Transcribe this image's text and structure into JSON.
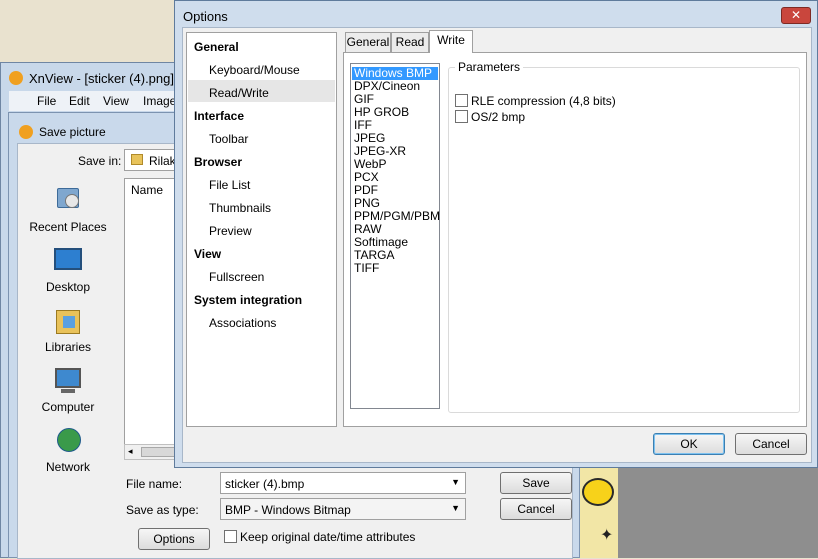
{
  "xnview": {
    "title": "XnView - [sticker (4).png]",
    "menu": [
      "File",
      "Edit",
      "View",
      "Image"
    ]
  },
  "save_dialog": {
    "title": "Save picture",
    "save_in_label": "Save in:",
    "save_in_value": "Rilakku",
    "column_name": "Name",
    "places": [
      "Recent Places",
      "Desktop",
      "Libraries",
      "Computer",
      "Network"
    ],
    "file_name_label": "File name:",
    "file_name_value": "sticker (4).bmp",
    "save_type_label": "Save as type:",
    "save_type_value": "BMP - Windows Bitmap",
    "save_button": "Save",
    "cancel_button": "Cancel",
    "options_button": "Options",
    "keep_date_label": "Keep original date/time attributes"
  },
  "options_dialog": {
    "title": "Options",
    "close_glyph": "✕",
    "nav": [
      {
        "type": "head",
        "label": "General"
      },
      {
        "type": "item",
        "label": "Keyboard/Mouse"
      },
      {
        "type": "item",
        "label": "Read/Write",
        "selected": true
      },
      {
        "type": "head",
        "label": "Interface"
      },
      {
        "type": "item",
        "label": "Toolbar"
      },
      {
        "type": "head",
        "label": "Browser"
      },
      {
        "type": "item",
        "label": "File List"
      },
      {
        "type": "item",
        "label": "Thumbnails"
      },
      {
        "type": "item",
        "label": "Preview"
      },
      {
        "type": "head",
        "label": "View"
      },
      {
        "type": "item",
        "label": "Fullscreen"
      },
      {
        "type": "head",
        "label": "System integration"
      },
      {
        "type": "item",
        "label": "Associations"
      }
    ],
    "tabs": [
      "General",
      "Read",
      "Write"
    ],
    "active_tab": "Write",
    "formats": [
      "Windows BMP",
      "DPX/Cineon",
      "GIF",
      "HP GROB",
      "IFF",
      "JPEG",
      "JPEG-XR",
      "WebP",
      "PCX",
      "PDF",
      "PNG",
      "PPM/PGM/PBM",
      "RAW",
      "Softimage",
      "TARGA",
      "TIFF"
    ],
    "selected_format": "Windows BMP",
    "parameters_label": "Parameters",
    "params": [
      {
        "label": "RLE compression (4,8 bits)",
        "checked": false
      },
      {
        "label": "OS/2 bmp",
        "checked": false
      }
    ],
    "ok_button": "OK",
    "cancel_button": "Cancel"
  },
  "colors": {
    "selection": "#3399ff",
    "dialog_frame": "#cfdded",
    "close_button": "#c9463d"
  }
}
